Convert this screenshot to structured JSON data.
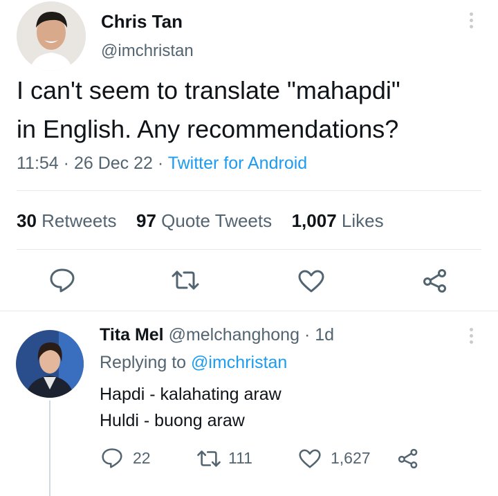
{
  "tweet": {
    "author_name": "Chris Tan",
    "author_handle": "@imchristan",
    "text_line1": "I can't seem to translate \"mahapdi\"",
    "text_line2": "in English. Any recommendations?",
    "time": "11:54",
    "date": "26 Dec 22",
    "source": "Twitter for Android",
    "sep": "·"
  },
  "stats": {
    "retweets_count": "30",
    "retweets_label": "Retweets",
    "quotes_count": "97",
    "quotes_label": "Quote Tweets",
    "likes_count": "1,007",
    "likes_label": "Likes"
  },
  "reply": {
    "author_name": "Tita Mel",
    "author_handle": "@melchanghong",
    "age": "1d",
    "sep": "·",
    "replying_prefix": "Replying to",
    "replying_handle": "@imchristan",
    "line1": "Hapdi - kalahating araw",
    "line2": "Huldi - buong araw",
    "replies": "22",
    "retweets": "111",
    "likes": "1,627"
  },
  "icons": {
    "reply": "reply-icon",
    "retweet": "retweet-icon",
    "like": "heart-icon",
    "share": "share-icon",
    "more": "more-icon"
  },
  "colors": {
    "link": "#1d9bf0",
    "secondary": "#536471",
    "text": "#0f1419"
  }
}
